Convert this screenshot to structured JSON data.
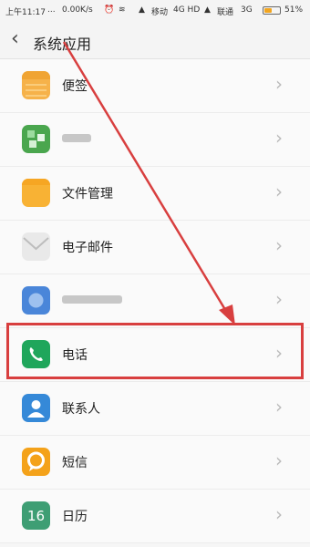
{
  "status_bar": {
    "time": "上午11:17",
    "dots": "...",
    "speed": "0.00K/s",
    "carrier1": "移动",
    "network1": "4G HD",
    "carrier2": "联通",
    "network2": "3G",
    "battery": "51%",
    "battery_level": 0.51
  },
  "header": {
    "back_icon": "‹",
    "title": "系统应用"
  },
  "items": [
    {
      "label": "便签",
      "icon": "notes-icon",
      "color": "#f6b24a"
    },
    {
      "label": "",
      "icon": "app-icon-blurred",
      "color": "#4aa64e"
    },
    {
      "label": "文件管理",
      "icon": "folder-icon",
      "color": "#f8b234"
    },
    {
      "label": "电子邮件",
      "icon": "mail-icon",
      "color": "#e9e9e9"
    },
    {
      "label": "",
      "icon": "app-icon-blurred",
      "color": "#4a86d9"
    },
    {
      "label": "电话",
      "icon": "phone-icon",
      "color": "#1fa65b"
    },
    {
      "label": "联系人",
      "icon": "contacts-icon",
      "color": "#3589d8"
    },
    {
      "label": "短信",
      "icon": "message-icon",
      "color": "#f4a21a"
    },
    {
      "label": "日历",
      "icon": "calendar-icon",
      "color": "#3e9e74"
    }
  ],
  "calendar_day": "16",
  "chevron": "›",
  "annotation_color": "#d83f3f"
}
